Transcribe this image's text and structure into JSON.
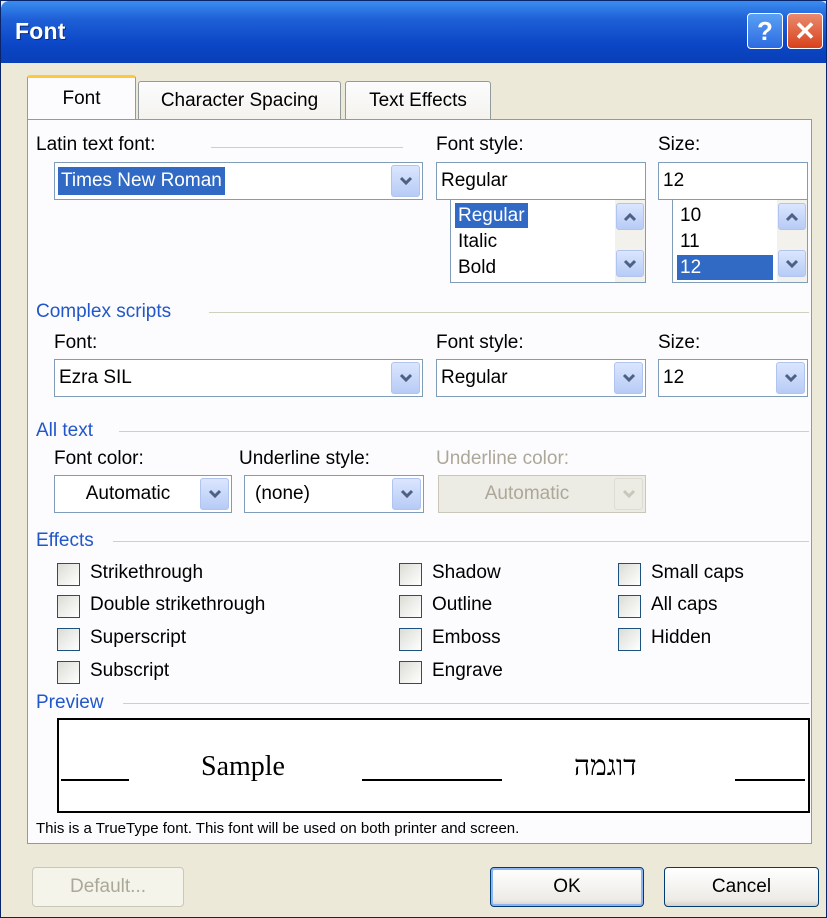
{
  "window": {
    "title": "Font",
    "help_glyph": "?",
    "close_glyph": "✕"
  },
  "tabs": [
    {
      "label": "Font",
      "active": true
    },
    {
      "label": "Character Spacing",
      "active": false
    },
    {
      "label": "Text Effects",
      "active": false
    }
  ],
  "latin": {
    "font_label": "Latin text font:",
    "font_value": "Times New Roman",
    "style_label": "Font style:",
    "style_value": "Regular",
    "style_options": [
      "Regular",
      "Italic",
      "Bold"
    ],
    "style_selected": "Regular",
    "size_label": "Size:",
    "size_value": "12",
    "size_options": [
      "10",
      "11",
      "12"
    ],
    "size_selected": "12"
  },
  "complex": {
    "section_label": "Complex scripts",
    "font_label": "Font:",
    "font_value": "Ezra SIL",
    "style_label": "Font style:",
    "style_value": "Regular",
    "size_label": "Size:",
    "size_value": "12"
  },
  "all_text": {
    "section_label": "All text",
    "font_color_label": "Font color:",
    "font_color_value": "Automatic",
    "underline_style_label": "Underline style:",
    "underline_style_value": "(none)",
    "underline_color_label": "Underline color:",
    "underline_color_value": "Automatic"
  },
  "effects": {
    "section_label": "Effects",
    "strikethrough": "Strikethrough",
    "double_strikethrough": "Double strikethrough",
    "superscript": "Superscript",
    "subscript": "Subscript",
    "shadow": "Shadow",
    "outline": "Outline",
    "emboss": "Emboss",
    "engrave": "Engrave",
    "small_caps": "Small caps",
    "all_caps": "All caps",
    "hidden": "Hidden"
  },
  "preview": {
    "section_label": "Preview",
    "latin_sample": "Sample",
    "complex_sample": "דוגמה",
    "note": "This is a TrueType font. This font will be used on both printer and screen."
  },
  "buttons": {
    "default": "Default...",
    "ok": "OK",
    "cancel": "Cancel"
  },
  "colors": {
    "title_bar": "#0b46c6",
    "section_text": "#2157c8",
    "selection": "#316ac5",
    "dialog_bg": "#ece9d8"
  }
}
